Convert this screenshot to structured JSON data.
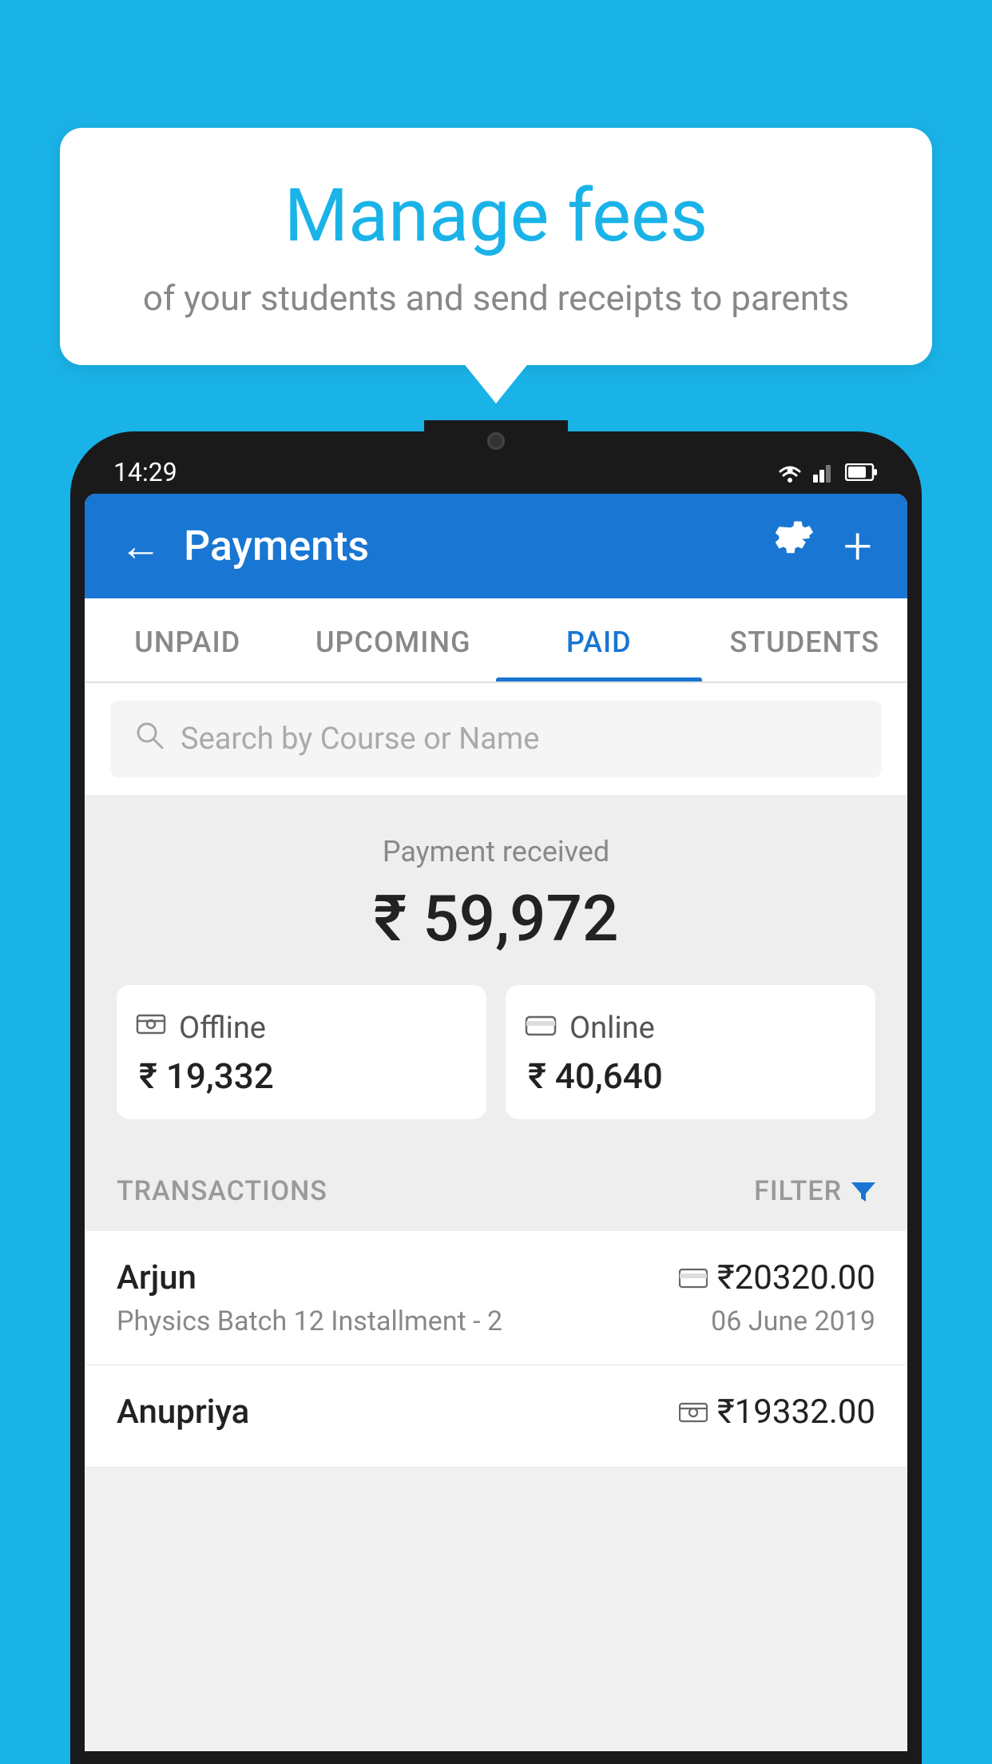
{
  "bubble": {
    "title": "Manage fees",
    "subtitle": "of your students and send receipts to parents"
  },
  "status_bar": {
    "time": "14:29"
  },
  "header": {
    "title": "Payments",
    "back_label": "←",
    "settings_label": "⚙",
    "add_label": "+"
  },
  "tabs": [
    {
      "id": "unpaid",
      "label": "UNPAID",
      "active": false
    },
    {
      "id": "upcoming",
      "label": "UPCOMING",
      "active": false
    },
    {
      "id": "paid",
      "label": "PAID",
      "active": true
    },
    {
      "id": "students",
      "label": "STUDENTS",
      "active": false
    }
  ],
  "search": {
    "placeholder": "Search by Course or Name"
  },
  "payment_summary": {
    "label": "Payment received",
    "total": "₹ 59,972",
    "offline": {
      "type": "Offline",
      "amount": "₹ 19,332"
    },
    "online": {
      "type": "Online",
      "amount": "₹ 40,640"
    }
  },
  "transactions": {
    "section_label": "TRANSACTIONS",
    "filter_label": "FILTER",
    "items": [
      {
        "name": "Arjun",
        "course": "Physics Batch 12 Installment - 2",
        "date": "06 June 2019",
        "amount": "₹20320.00",
        "payment_type": "card"
      },
      {
        "name": "Anupriya",
        "course": "",
        "date": "",
        "amount": "₹19332.00",
        "payment_type": "offline"
      }
    ]
  }
}
